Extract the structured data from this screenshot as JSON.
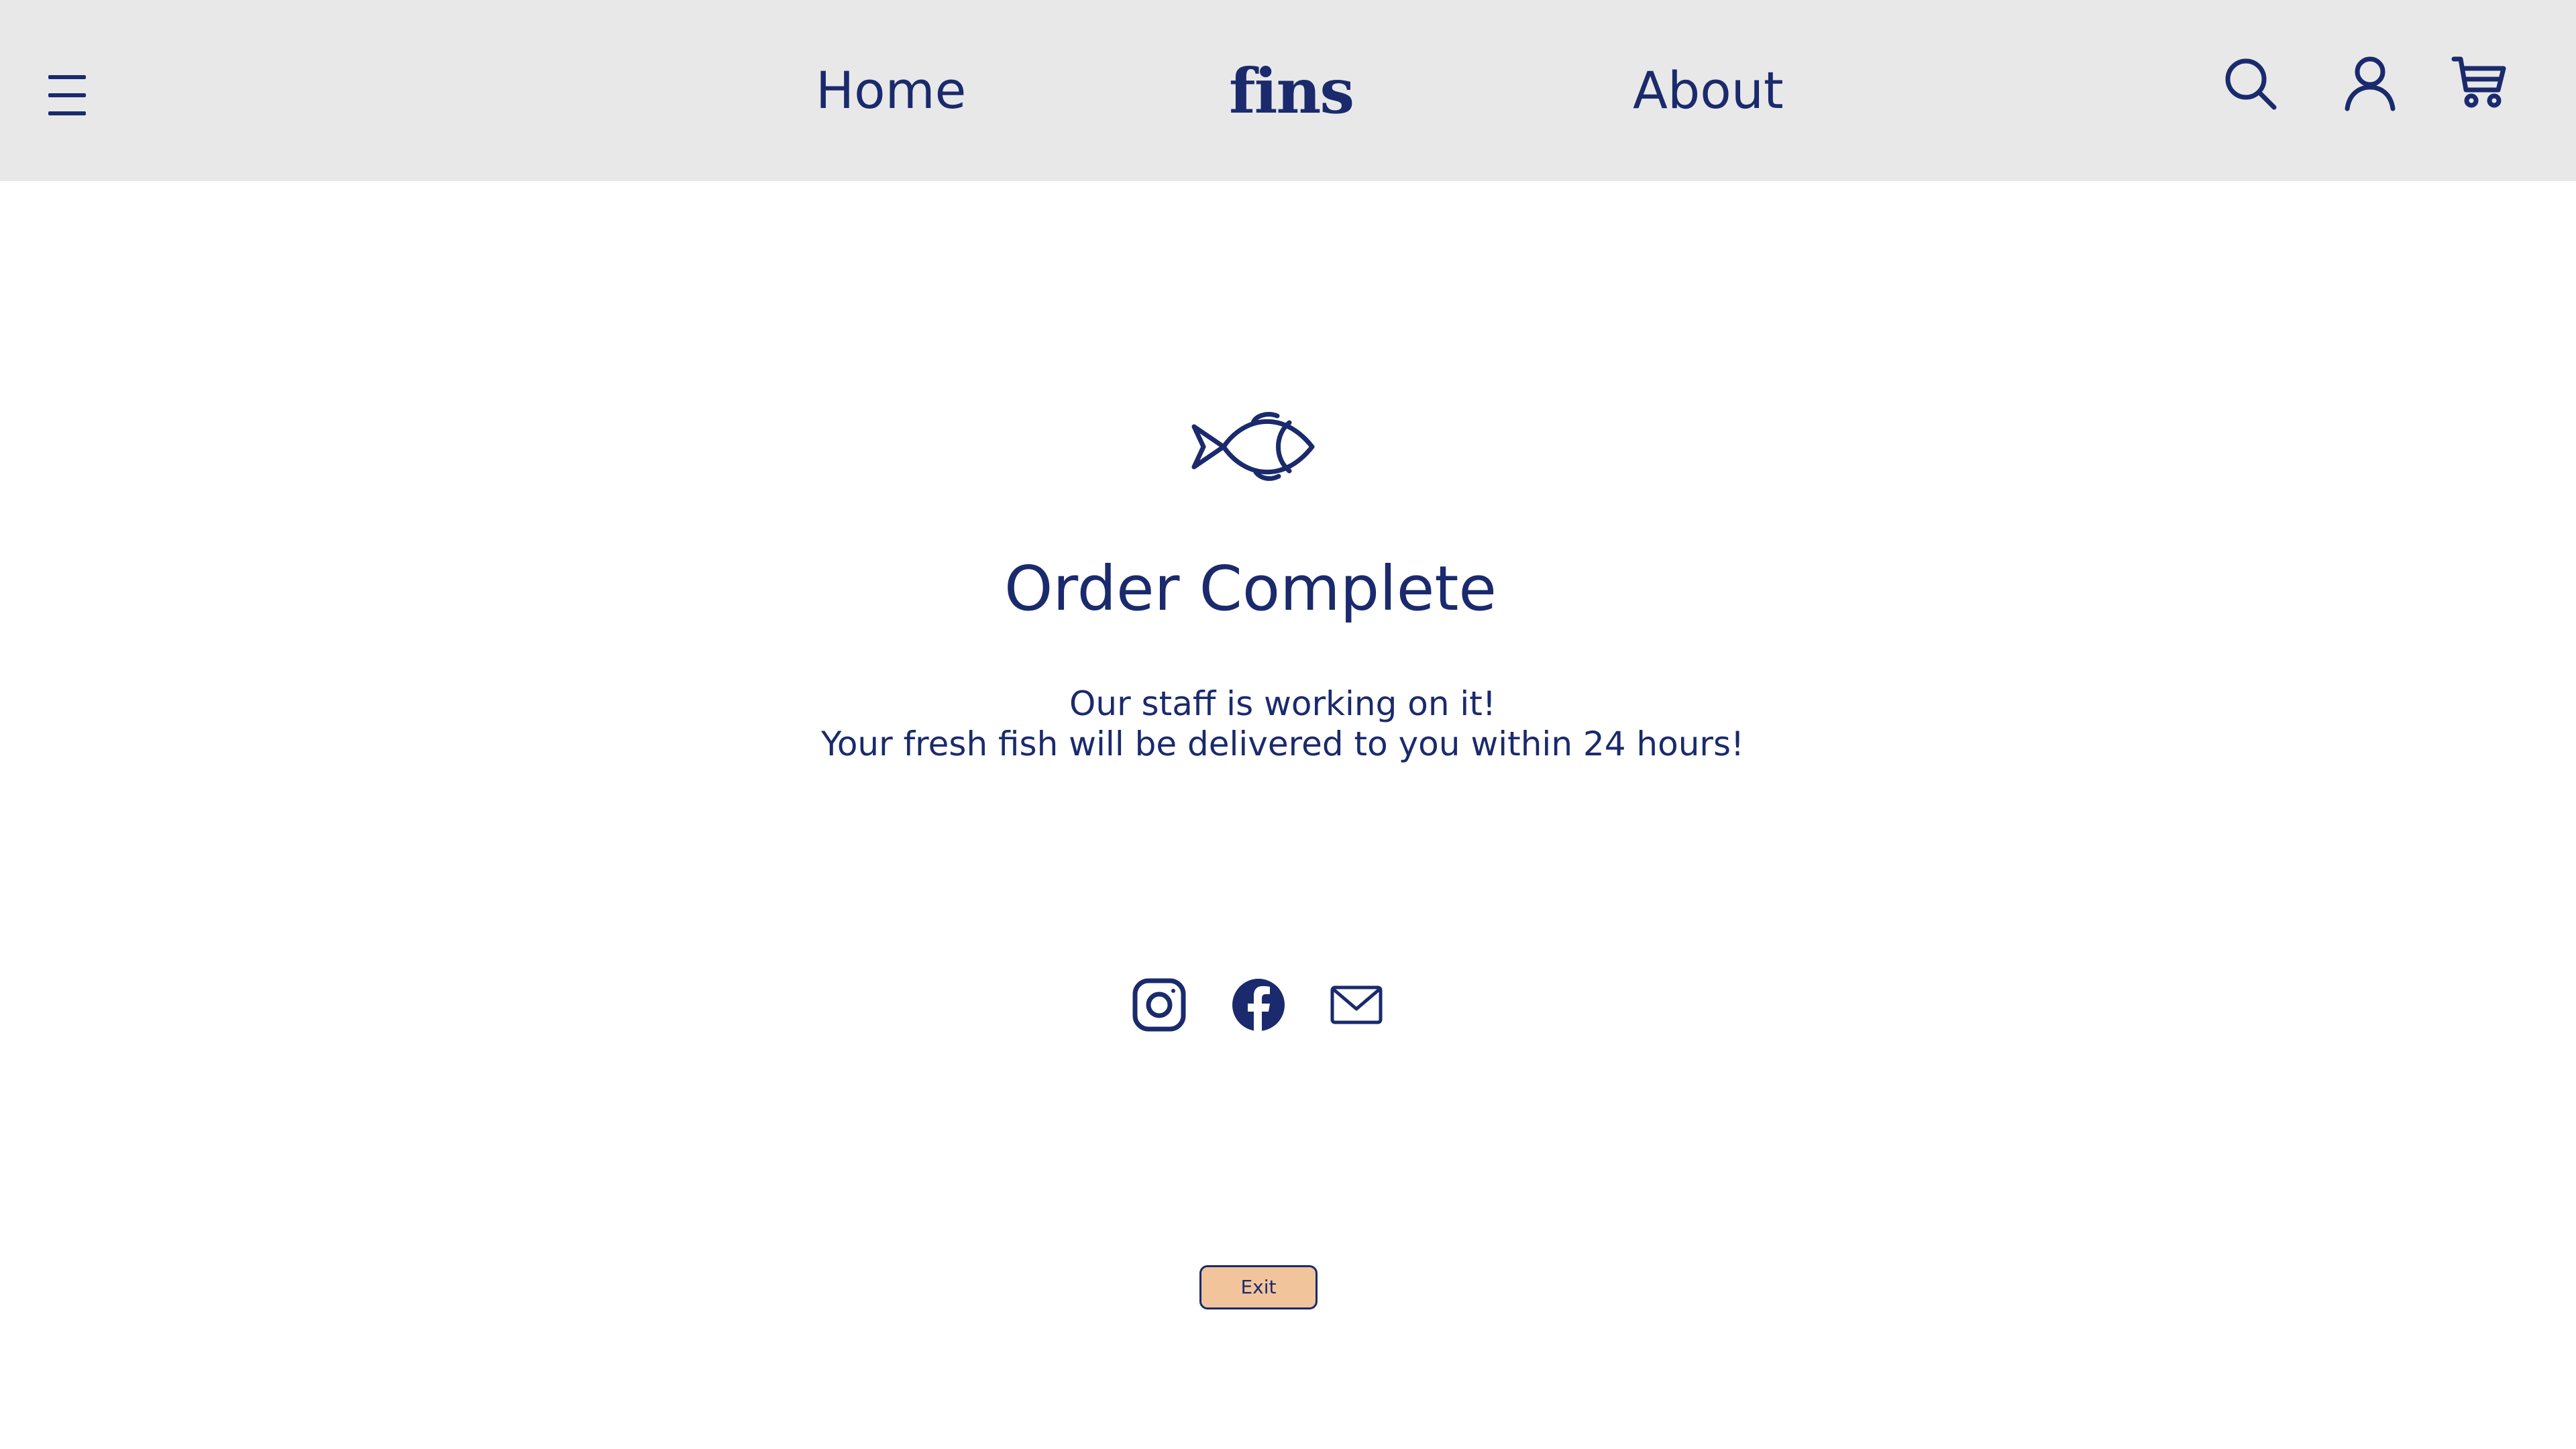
{
  "colors": {
    "brand": "#1a2a6c",
    "header_background": "#e8e8e9",
    "page_background": "#ffffff",
    "exit_button": "#f2c49c"
  },
  "header": {
    "menu_icon": "hamburger-menu-icon",
    "nav_home": "Home",
    "logo": "fins",
    "nav_about": "About",
    "icons": [
      "search-icon",
      "user-icon",
      "cart-icon"
    ]
  },
  "main": {
    "icon": "fish-icon",
    "title": "Order Complete",
    "message_line1": "Our staff is working on it!",
    "message_line2": "Your fresh fish will be delivered to you within 24 hours!"
  },
  "social": {
    "icons": [
      "instagram-icon",
      "facebook-icon",
      "mail-icon"
    ]
  },
  "actions": {
    "exit_label": "Exit"
  }
}
